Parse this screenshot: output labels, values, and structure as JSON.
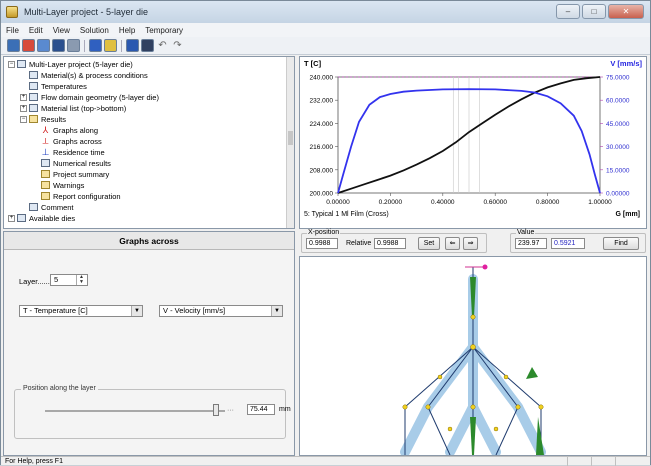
{
  "window": {
    "title": "Multi-Layer project - 5-layer die"
  },
  "menu": [
    "File",
    "Edit",
    "View",
    "Solution",
    "Help",
    "Temporary"
  ],
  "toolbar": [
    {
      "icon": "new-icon",
      "color": "#3b6fb6"
    },
    {
      "icon": "open-icon",
      "color": "#d84a3a"
    },
    {
      "icon": "edit-icon",
      "color": "#5a8ad0"
    },
    {
      "icon": "save-icon",
      "color": "#2a4f8e"
    },
    {
      "icon": "print-icon",
      "color": "#8a9ab0"
    },
    {
      "icon": "solve-icon",
      "color": "#3060c0"
    },
    {
      "icon": "chart-icon",
      "color": "#e0c040"
    },
    {
      "icon": "report-icon",
      "color": "#2a58b0"
    },
    {
      "icon": "help-icon",
      "color": "#304060"
    }
  ],
  "tree": {
    "nodes": [
      {
        "label": "Multi-Layer project (5-layer die)",
        "icon": "project-icon",
        "depth": 0,
        "exp": "−"
      },
      {
        "label": "Material(s) & process conditions",
        "icon": "doc-icon",
        "depth": 1,
        "exp": ""
      },
      {
        "label": "Temperatures",
        "icon": "doc-icon",
        "depth": 1,
        "exp": ""
      },
      {
        "label": "Flow domain geometry (5-layer die)",
        "icon": "doc-icon",
        "depth": 1,
        "exp": "+"
      },
      {
        "label": "Material list (top->bottom)",
        "icon": "doc-icon",
        "depth": 1,
        "exp": "+"
      },
      {
        "label": "Results",
        "icon": "results-icon",
        "depth": 1,
        "exp": "−"
      },
      {
        "label": "Graphs along",
        "icon": "graph-along-icon",
        "depth": 2,
        "exp": ""
      },
      {
        "label": "Graphs across",
        "icon": "graph-across-icon",
        "depth": 2,
        "exp": ""
      },
      {
        "label": "Residence time",
        "icon": "residence-icon",
        "depth": 2,
        "exp": ""
      },
      {
        "label": "Numerical results",
        "icon": "numerical-icon",
        "depth": 2,
        "exp": ""
      },
      {
        "label": "Project summary",
        "icon": "summary-icon",
        "depth": 2,
        "exp": ""
      },
      {
        "label": "Warnings",
        "icon": "warnings-icon",
        "depth": 2,
        "exp": ""
      },
      {
        "label": "Report configuration",
        "icon": "report-config-icon",
        "depth": 2,
        "exp": ""
      },
      {
        "label": "Comment",
        "icon": "comment-icon",
        "depth": 1,
        "exp": ""
      },
      {
        "label": "Available dies",
        "icon": "dies-icon",
        "depth": 0,
        "exp": "+"
      }
    ]
  },
  "graphs_across": {
    "header": "Graphs across",
    "layer_label": "Layer............",
    "layer_value": "5",
    "left_select": "T - Temperature [C]",
    "right_select": "V - Velocity [mm/s]",
    "position_label": "Position along the layer",
    "position_value": "75.44",
    "position_unit": "mm",
    "slider_fraction": 0.95
  },
  "chart": {
    "left_header": "T [C]",
    "right_header": "V [mm/s]",
    "curve_label": "5: Typical 1 Ml Film (Cross)",
    "x_unit": "G [mm]"
  },
  "chart_data": {
    "type": "line",
    "x_ticks": [
      "0.00000",
      "0.20000",
      "0.40000",
      "0.60000",
      "0.80000",
      "1.00000"
    ],
    "y_left_ticks": [
      "200.000",
      "208.000",
      "216.000",
      "224.000",
      "232.000",
      "240.000"
    ],
    "y_right_ticks": [
      "0.00000",
      "15.0000",
      "30.0000",
      "45.0000",
      "60.0000",
      "75.0000"
    ],
    "xlim": [
      0,
      1
    ],
    "ylim_left": [
      200,
      240
    ],
    "ylim_right": [
      0,
      75
    ],
    "vlines": [
      0.44,
      0.46,
      0.5,
      0.54
    ],
    "series": [
      {
        "color": "#111111",
        "axis": "left",
        "x": [
          0,
          0.05,
          0.1,
          0.15,
          0.2,
          0.25,
          0.3,
          0.35,
          0.4,
          0.45,
          0.5,
          0.55,
          0.6,
          0.65,
          0.7,
          0.75,
          0.8,
          0.85,
          0.9,
          0.95,
          1.0
        ],
        "values": [
          200,
          201.5,
          203,
          204.5,
          206,
          207.8,
          209.8,
          212,
          214.5,
          217.5,
          221,
          224,
          227,
          229.8,
          232.3,
          234.6,
          236.4,
          237.8,
          239,
          239.6,
          240
        ]
      },
      {
        "color": "#3333ee",
        "axis": "right",
        "x": [
          0,
          0.02,
          0.05,
          0.08,
          0.12,
          0.16,
          0.2,
          0.25,
          0.3,
          0.4,
          0.5,
          0.6,
          0.7,
          0.75,
          0.8,
          0.85,
          0.9,
          0.93,
          0.96,
          0.98,
          1.0
        ],
        "values": [
          0,
          12,
          30,
          46,
          57,
          62,
          64,
          65.5,
          66.2,
          67,
          67.2,
          67,
          66,
          65,
          62.5,
          58,
          50,
          40,
          25,
          12,
          0
        ]
      }
    ]
  },
  "xposition": {
    "label": "X-position",
    "value": "0.9988",
    "relative_label": "Relative",
    "relative_value": "0.9988",
    "set_label": "Set"
  },
  "value_box": {
    "label": "Value",
    "left_value": "239.97",
    "right_value": "0.5921",
    "find_label": "Find"
  },
  "status": {
    "text": "For Help, press F1"
  }
}
